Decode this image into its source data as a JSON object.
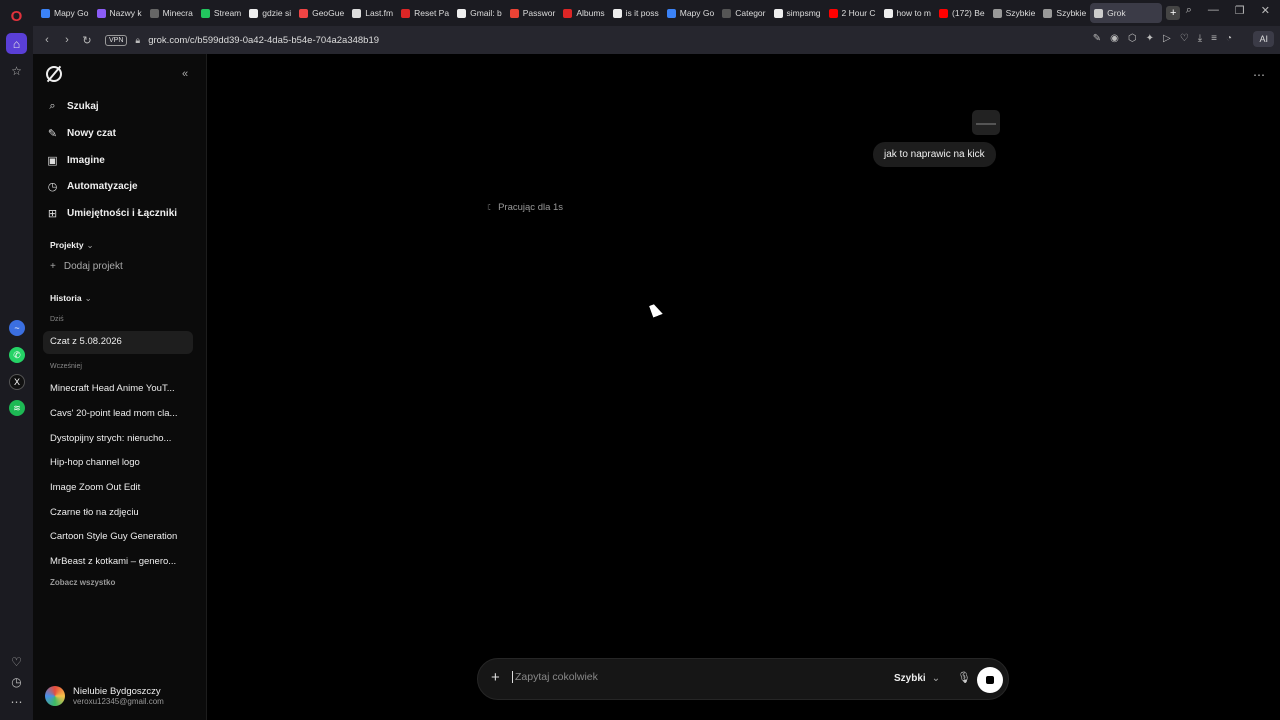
{
  "tabs": [
    {
      "label": "Mapy Go",
      "color": "#3b82f6"
    },
    {
      "label": "Nazwy k",
      "color": "#8b5cf6"
    },
    {
      "label": "Minecra",
      "color": "#666"
    },
    {
      "label": "Stream",
      "color": "#22c55e"
    },
    {
      "label": "gdzie si",
      "color": "#eee"
    },
    {
      "label": "GeoGue",
      "color": "#ef4444"
    },
    {
      "label": "Last.fm",
      "color": "#ddd"
    },
    {
      "label": "Reset Pa",
      "color": "#dc2626"
    },
    {
      "label": "Gmail: b",
      "color": "#eee"
    },
    {
      "label": "Passwor",
      "color": "#ea4335"
    },
    {
      "label": "Albums",
      "color": "#dc2626"
    },
    {
      "label": "is it poss",
      "color": "#eee"
    },
    {
      "label": "Mapy Go",
      "color": "#3b82f6"
    },
    {
      "label": "Categor",
      "color": "#555"
    },
    {
      "label": "simpsmg",
      "color": "#eee"
    },
    {
      "label": "2 Hour C",
      "color": "#ff0000"
    },
    {
      "label": "how to m",
      "color": "#eee"
    },
    {
      "label": "(172) Be",
      "color": "#ff0000"
    },
    {
      "label": "Szybkie",
      "color": "#999"
    },
    {
      "label": "Szybkie",
      "color": "#999"
    },
    {
      "label": "Grok",
      "color": "#ccc"
    }
  ],
  "address": {
    "vpn": "VPN",
    "url": "grok.com/c/b599dd39-0a42-4da5-b54e-704a2a348b19",
    "ai_label": "AI"
  },
  "sidebar": {
    "nav": [
      {
        "label": "Szukaj",
        "icon": "search-icon",
        "glyph": "⌕"
      },
      {
        "label": "Nowy czat",
        "icon": "edit-icon",
        "glyph": "✎"
      },
      {
        "label": "Imagine",
        "icon": "image-icon",
        "glyph": "▣"
      },
      {
        "label": "Automatyzacje",
        "icon": "clock-icon",
        "glyph": "◷"
      },
      {
        "label": "Umiejętności i Łączniki",
        "icon": "grid-icon",
        "glyph": "⊞"
      }
    ],
    "projects_label": "Projekty",
    "add_project": "Dodaj projekt",
    "history_label": "Historia",
    "today_label": "Dziś",
    "today_items": [
      "Czat z 5.08.2026"
    ],
    "earlier_label": "Wcześniej",
    "earlier_items": [
      "Minecraft Head Anime YouT...",
      "Cavs' 20-point lead mom cla...",
      "Dystopijny strych: nierucho...",
      "Hip-hop channel logo",
      "Image Zoom Out Edit",
      "Czarne tło na zdjęciu",
      "Cartoon Style Guy Generation",
      "MrBeast z kotkami – genero..."
    ],
    "see_all": "Zobacz wszystko",
    "user": {
      "name": "Nielubie Bydgoszczy",
      "email": "veroxu12345@gmail.com"
    }
  },
  "chat": {
    "user_message": "jak to naprawic na kick",
    "status": "Pracując dla 1s"
  },
  "composer": {
    "placeholder": "Zapytaj cokolwiek",
    "model": "Szybki"
  }
}
